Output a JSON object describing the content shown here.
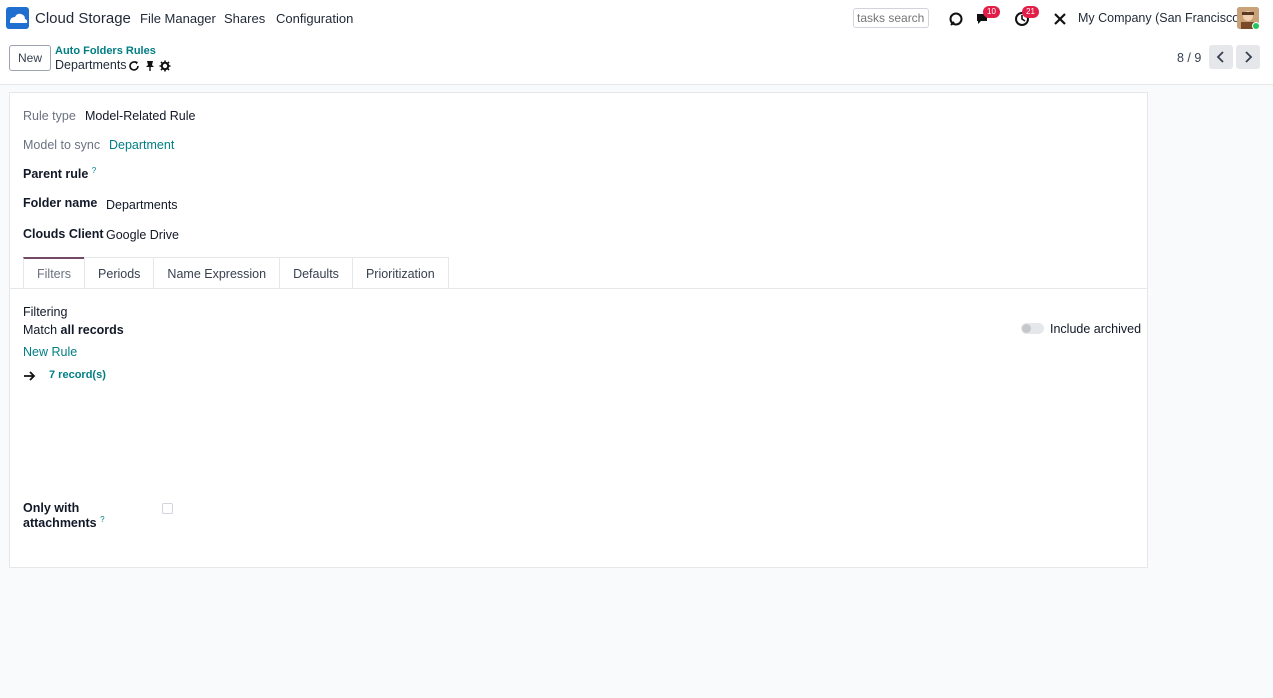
{
  "app": {
    "name": "Cloud Storage"
  },
  "nav": {
    "items": [
      "File Manager",
      "Shares",
      "Configuration"
    ]
  },
  "search": {
    "placeholder": "tasks search"
  },
  "systray": {
    "messages_count": "10",
    "activities_count": "21",
    "company": "My Company (San Francisco)"
  },
  "breadcrumb": {
    "parent": "Auto Folders Rules",
    "current": "Departments"
  },
  "control": {
    "new_label": "New",
    "pager": "8 / 9"
  },
  "form": {
    "rule_type": {
      "label": "Rule type",
      "value": "Model-Related Rule"
    },
    "model_to_sync": {
      "label": "Model to sync",
      "value": "Department"
    },
    "parent_rule": {
      "label": "Parent rule",
      "help": "?"
    },
    "folder_name": {
      "label": "Folder name",
      "value": "Departments"
    },
    "clouds_client": {
      "label": "Clouds Client",
      "value": "Google Drive"
    }
  },
  "tabs": [
    "Filters",
    "Periods",
    "Name Expression",
    "Defaults",
    "Prioritization"
  ],
  "filters": {
    "heading": "Filtering",
    "match_prefix": "Match",
    "match_value": "all records",
    "include_archived": "Include archived",
    "new_rule": "New Rule",
    "records": "7 record(s)",
    "only_with_line1": "Only with",
    "only_with_line2": "attachments",
    "help": "?"
  },
  "colors": {
    "accent": "#017e84",
    "tab_active_border": "#714b67",
    "badge": "#e11d48",
    "logo": "#1f6fd1"
  }
}
